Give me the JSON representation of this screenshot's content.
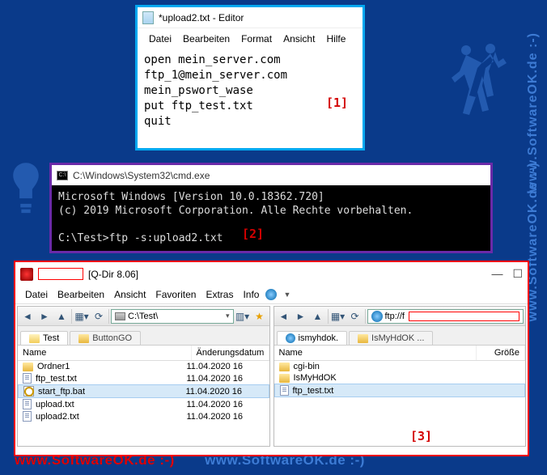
{
  "sidebar_text": "www.SoftwareOK.de :-)",
  "bottom_text": "www.SoftwareOK.de :-)",
  "markers": {
    "m1": "[1]",
    "m2": "[2]",
    "m3": "[3]"
  },
  "notepad": {
    "title": "*upload2.txt - Editor",
    "menu": [
      "Datei",
      "Bearbeiten",
      "Format",
      "Ansicht",
      "Hilfe"
    ],
    "content": "open mein_server.com\nftp_1@mein_server.com\nmein_pswort_wase\nput ftp_test.txt\nquit"
  },
  "cmd": {
    "title": "C:\\Windows\\System32\\cmd.exe",
    "lines": "Microsoft Windows [Version 10.0.18362.720]\n(c) 2019 Microsoft Corporation. Alle Rechte vorbehalten.\n\nC:\\Test>ftp -s:upload2.txt"
  },
  "qdir": {
    "title": "[Q-Dir 8.06]",
    "menu": [
      "Datei",
      "Bearbeiten",
      "Ansicht",
      "Favoriten",
      "Extras",
      "Info"
    ],
    "minBtn": "—",
    "maxBtn": "☐",
    "left": {
      "path": "C:\\Test\\",
      "tabs": [
        "Test",
        "ButtonGO"
      ],
      "cols": {
        "name": "Name",
        "date": "Änderungsdatum"
      },
      "items": [
        {
          "n": "Ordner1",
          "d": "11.04.2020 16",
          "t": "folder"
        },
        {
          "n": "ftp_test.txt",
          "d": "11.04.2020 16",
          "t": "file"
        },
        {
          "n": "start_ftp.bat",
          "d": "11.04.2020 16",
          "t": "bat",
          "sel": true
        },
        {
          "n": "upload.txt",
          "d": "11.04.2020 16",
          "t": "file"
        },
        {
          "n": "upload2.txt",
          "d": "11.04.2020 16",
          "t": "file"
        }
      ]
    },
    "right": {
      "path": "ftp://f",
      "tabs": [
        {
          "n": "ismyhdok.",
          "ico": "globe"
        },
        {
          "n": "IsMyHdOK ...",
          "ico": "folder"
        }
      ],
      "cols": {
        "name": "Name",
        "size": "Größe"
      },
      "items": [
        {
          "n": "cgi-bin",
          "t": "folder"
        },
        {
          "n": "IsMyHdOK",
          "t": "folder"
        },
        {
          "n": "ftp_test.txt",
          "t": "file",
          "sel": true
        }
      ]
    }
  }
}
